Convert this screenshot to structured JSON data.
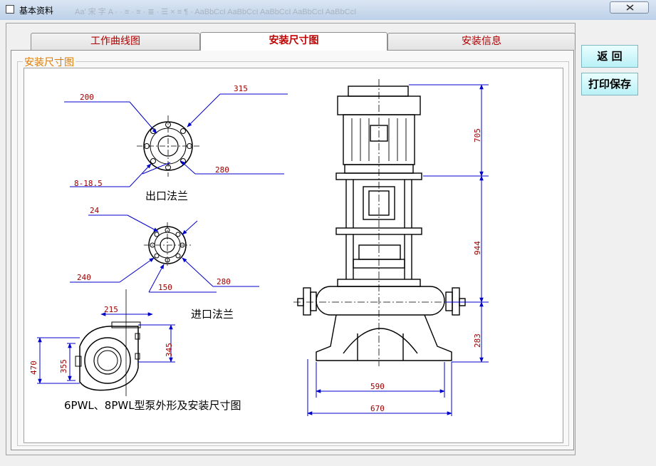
{
  "window": {
    "title": "基本资料"
  },
  "tabs": [
    "工作曲线图",
    "安装尺寸图",
    "安装信息"
  ],
  "active_tab": 1,
  "group": {
    "label": "安装尺寸图"
  },
  "buttons": {
    "back": "返 回",
    "print_save": "打印保存"
  },
  "drawing": {
    "outlet_flange": {
      "caption": "出口法兰",
      "d200": "200",
      "d315": "315",
      "d280": "280",
      "holes": "8-18.5"
    },
    "inlet_flange": {
      "caption": "进口法兰",
      "d24": "24",
      "d240": "240",
      "d150": "150",
      "d280": "280"
    },
    "side_view": {
      "d215": "215",
      "d470": "470",
      "d355": "355",
      "d345": "345"
    },
    "pump_dims": {
      "h705": "705",
      "h944": "944",
      "h283": "283",
      "w590": "590",
      "w670": "670"
    },
    "main_caption": "6PWL、8PWL型泵外形及安装尺寸图"
  }
}
